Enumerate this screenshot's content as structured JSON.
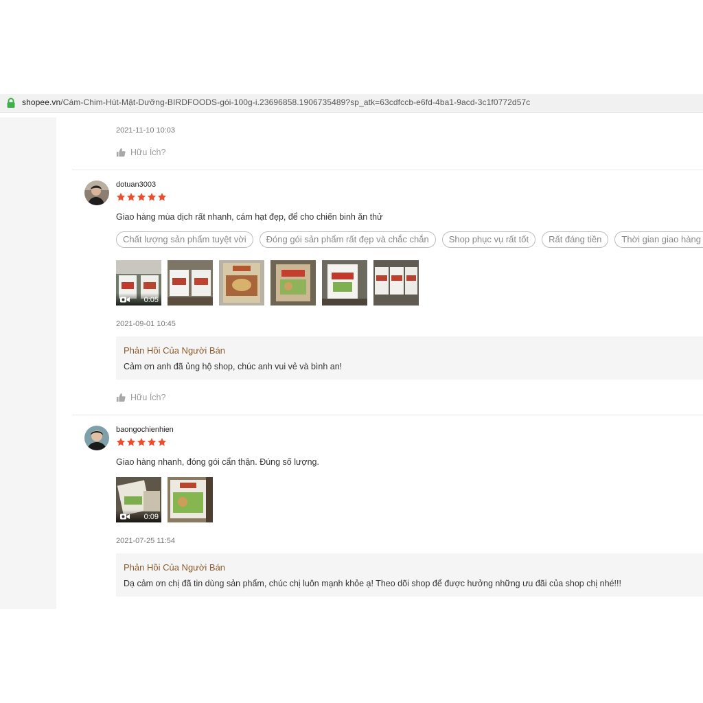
{
  "address_bar": {
    "host": "shopee.vn",
    "path": "/Cám-Chim-Hút-Mật-Dưỡng-BIRDFOODS-gói-100g-i.23696858.1906735489?sp_atk=63cdfccb-e6fd-4ba1-9acd-3c1f0772d57c"
  },
  "colors": {
    "star": "#ee4d2d",
    "seller_reply_title": "#8b5a2b",
    "secure_lock": "#3db24b"
  },
  "reviews": [
    {
      "date": "2021-11-10 10:03",
      "helpful_label": "Hữu Ích?"
    },
    {
      "username": "dotuan3003",
      "rating": 5,
      "comment": "Giao hàng mùa dịch rất nhanh, cám hạt đẹp, để cho chiến binh ăn thử",
      "tags": [
        "Chất lượng sản phẩm tuyệt vời",
        "Đóng gói sản phẩm rất đẹp và chắc chắn",
        "Shop phục vụ rất tốt",
        "Rất đáng tiền",
        "Thời gian giao hàng rất nhanh"
      ],
      "media": [
        {
          "type": "video",
          "duration": "0:05"
        },
        {
          "type": "image"
        },
        {
          "type": "image"
        },
        {
          "type": "image"
        },
        {
          "type": "image"
        },
        {
          "type": "image"
        }
      ],
      "date": "2021-09-01 10:45",
      "seller_reply_title": "Phản Hồi Của Người Bán",
      "seller_reply": "Cảm ơn anh đã ủng hộ shop, chúc anh vui vẻ và bình an!",
      "helpful_label": "Hữu Ích?"
    },
    {
      "username": "baongochienhien",
      "rating": 5,
      "comment": "Giao hàng nhanh, đóng gói cẩn thận. Đúng số lượng.",
      "media": [
        {
          "type": "video",
          "duration": "0:09"
        },
        {
          "type": "image"
        }
      ],
      "date": "2021-07-25 11:54",
      "seller_reply_title": "Phản Hồi Của Người Bán",
      "seller_reply": "Dạ cảm ơn chị đã tin dùng sản phẩm, chúc chị luôn mạnh khỏe ạ! Theo dõi shop để được hưởng những ưu đãi của shop chị nhé!!!"
    }
  ]
}
